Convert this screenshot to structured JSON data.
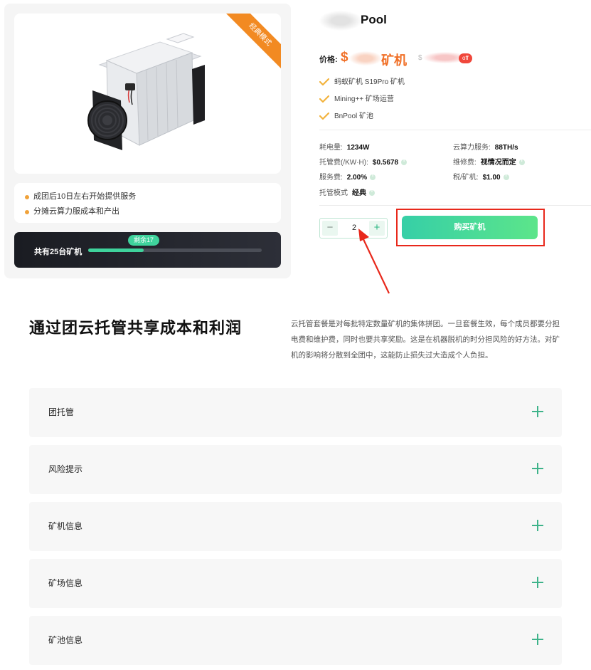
{
  "product": {
    "ribbon": "经典模式",
    "features": [
      "成团后10日左右开始提供服务",
      "分摊云算力服成本和产出"
    ],
    "progress": {
      "label": "共有25台矿机",
      "badge": "剩余17",
      "total": 25,
      "remaining": 17,
      "fill_fraction": 0.32
    }
  },
  "info": {
    "title": "Pool",
    "price_label": "价格:",
    "price_currency": "$",
    "price_unit": "矿机",
    "original_currency": "$",
    "off_badge": "off",
    "checks": [
      "蚂蚁矿机 S19Pro 矿机",
      "Mining++ 矿场运营",
      "BnPool 矿池"
    ],
    "specs": [
      {
        "label": "耗电量:",
        "value": "1234W",
        "info": false
      },
      {
        "label": "云算力服务:",
        "value": "88TH/s",
        "info": false
      },
      {
        "label": "托管费(/KW·H):",
        "value": "$0.5678",
        "info": true
      },
      {
        "label": "维修费:",
        "value": "视情况而定",
        "info": true
      },
      {
        "label": "服务费:",
        "value": "2.00%",
        "info": true
      },
      {
        "label": "税/矿机:",
        "value": "$1.00",
        "info": true
      },
      {
        "label": "托管模式",
        "value": "经典",
        "info": true
      }
    ],
    "quantity": "2",
    "minus": "−",
    "plus": "+",
    "buy_label": "购买矿机"
  },
  "section": {
    "title": "通过团云托管共享成本和利润",
    "description": "云托管套餐是对每批特定数量矿机的集体拼团。一旦套餐生效，每个成员都要分担电费和维护费，同时也要共享奖励。这是在机器脱机的时分担风险的好方法。对矿机的影响将分散到全团中，这能防止损失过大造成个人负担。"
  },
  "accordion": [
    "团托管",
    "风险提示",
    "矿机信息",
    "矿场信息",
    "矿池信息"
  ],
  "colors": {
    "accent_green": "#3fd39c",
    "price_orange": "#f06f26",
    "highlight_red": "#e8281b",
    "ribbon_orange": "#f28a22"
  }
}
